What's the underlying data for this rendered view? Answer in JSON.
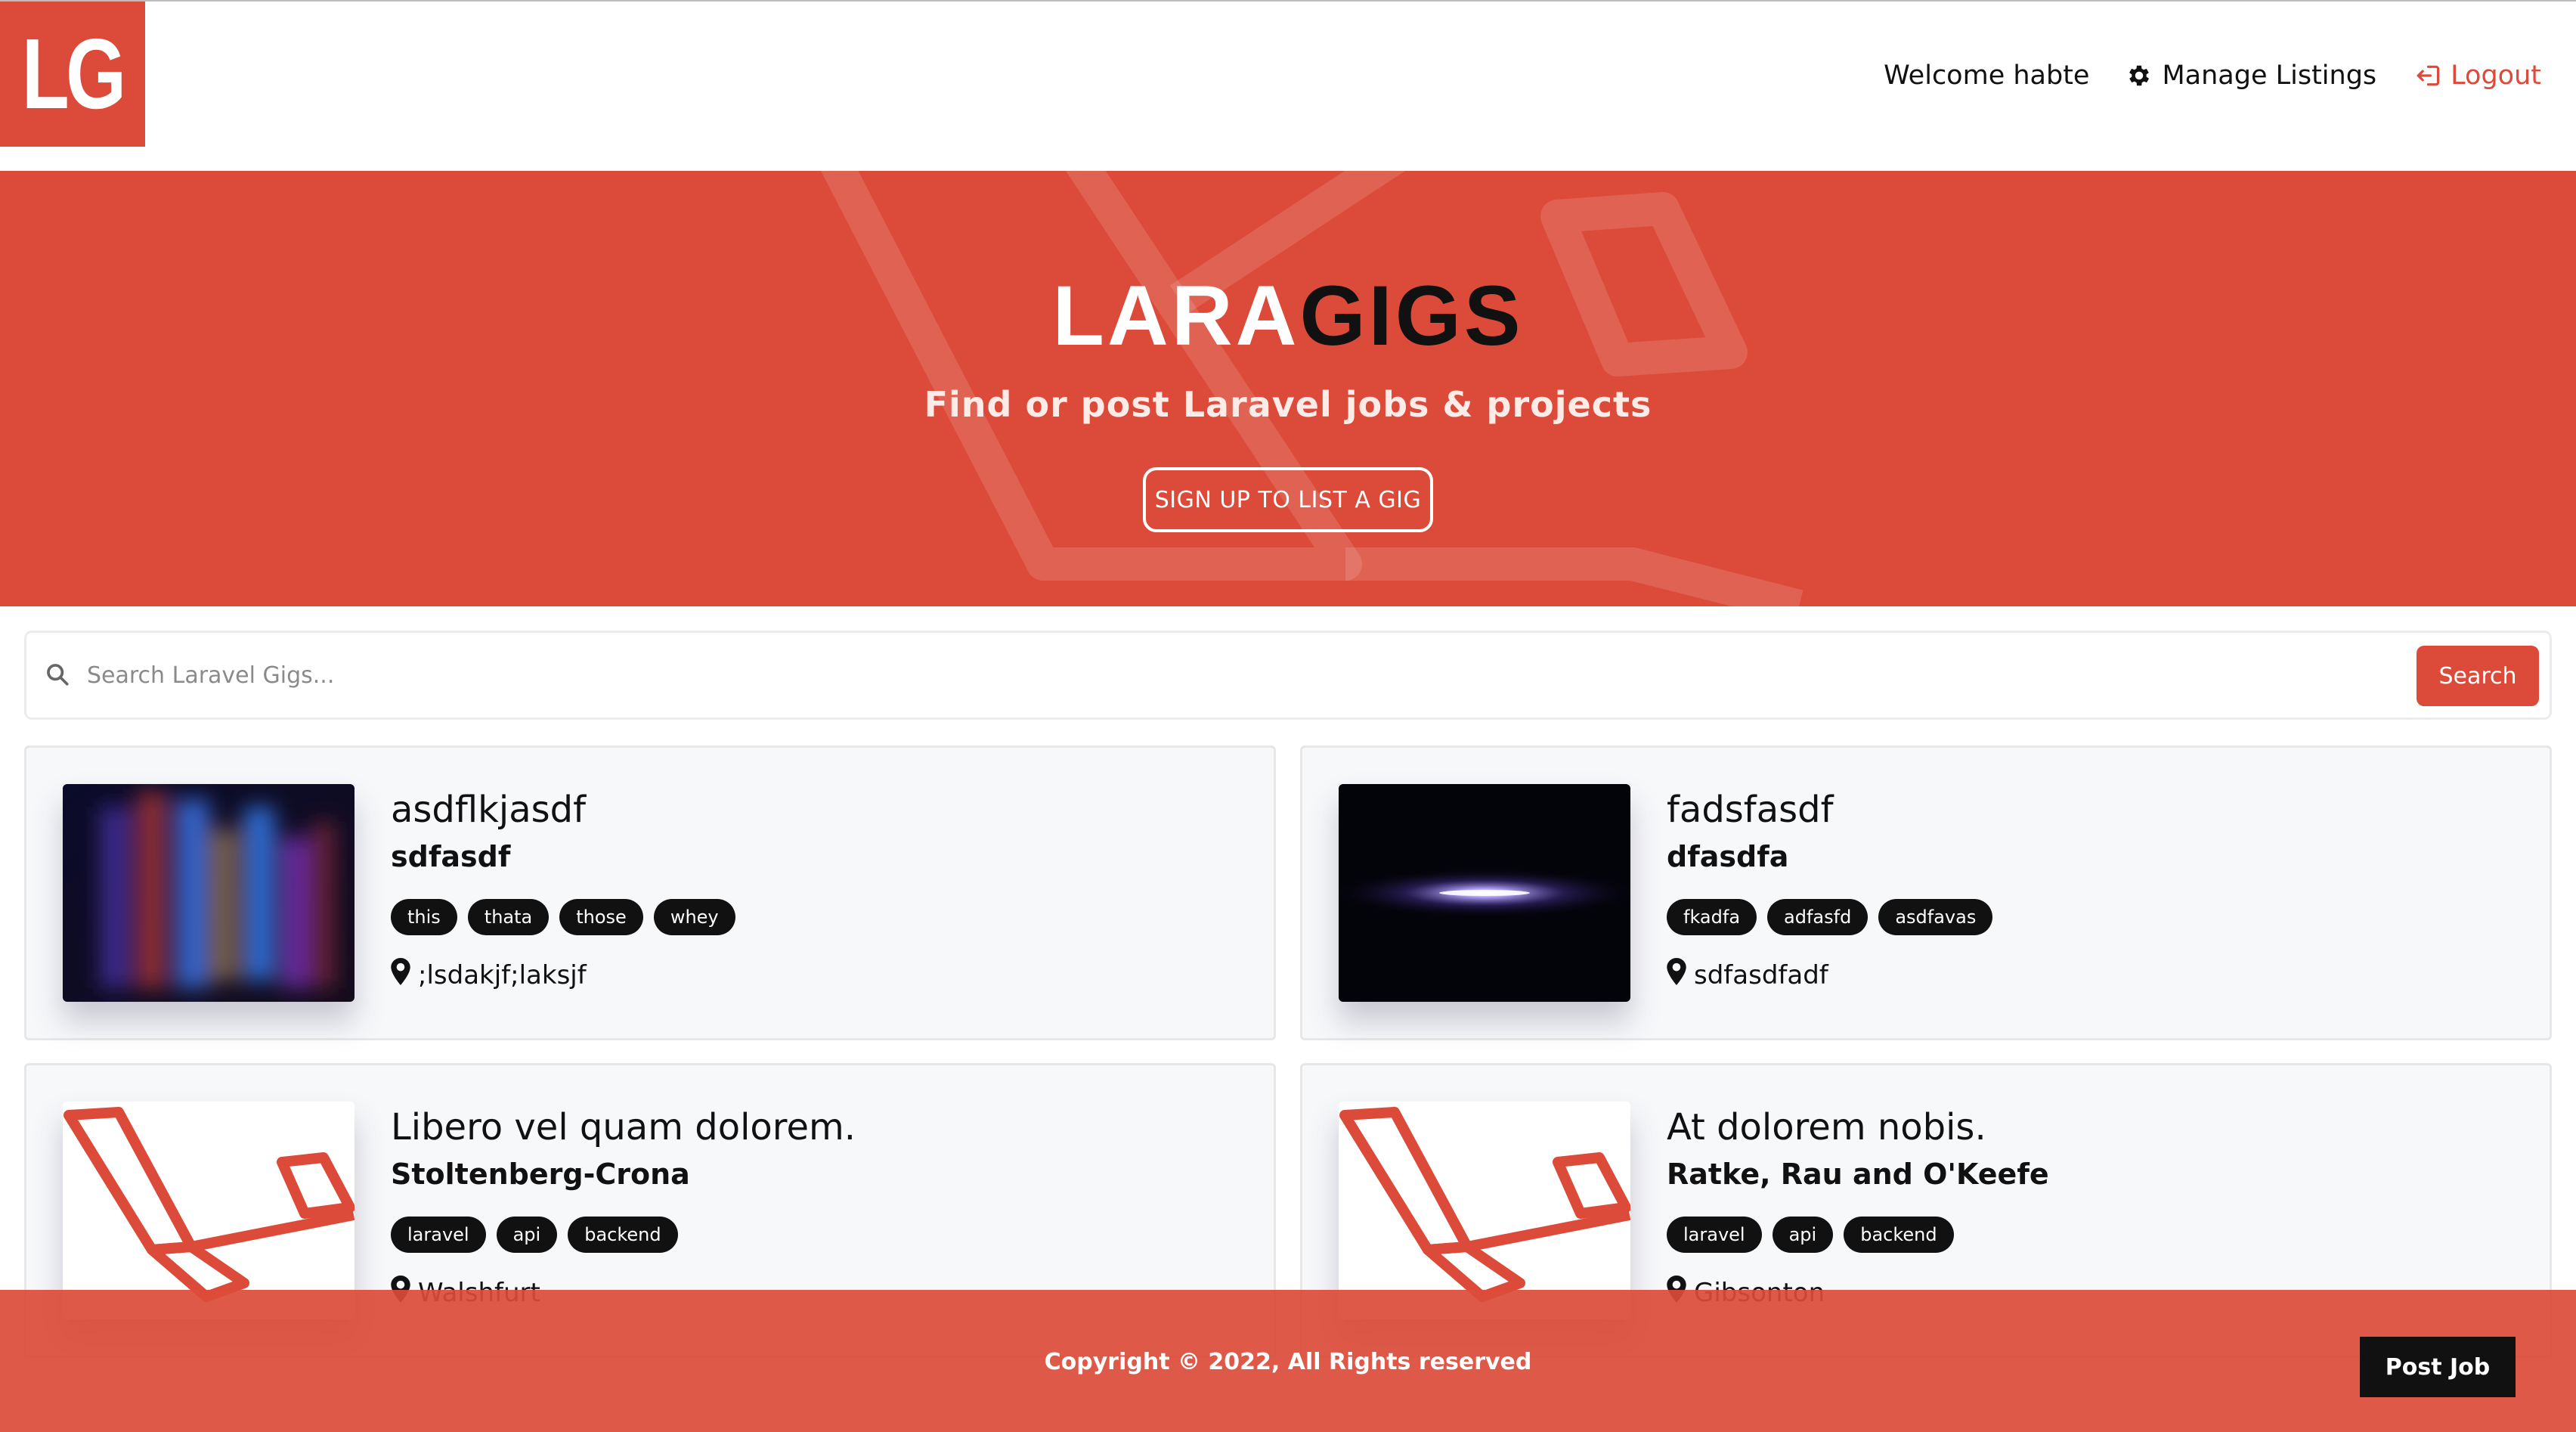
{
  "brand": {
    "logo_text": "LG",
    "accent": "#dc4b3a"
  },
  "nav": {
    "welcome": "Welcome habte",
    "manage": {
      "label": "Manage Listings",
      "icon": "gear-icon"
    },
    "logout": {
      "label": "Logout",
      "icon": "logout-icon"
    }
  },
  "hero": {
    "title_a": "LARA",
    "title_b": "GIGS",
    "subtitle": "Find or post Laravel jobs & projects",
    "cta": "SIGN UP TO LIST A GIG"
  },
  "search": {
    "placeholder": "Search Laravel Gigs...",
    "button": "Search",
    "icon": "search-icon"
  },
  "listings": [
    {
      "title": "asdflkjasdf",
      "company": "sdfasdf",
      "tags": [
        "this",
        "thata",
        "those",
        "whey"
      ],
      "location": ";lsdakjf;laksjf",
      "image": "abstract-blur"
    },
    {
      "title": "fadsfasdf",
      "company": "dfasdfa",
      "tags": [
        "fkadfa",
        "adfasfd",
        "asdfavas"
      ],
      "location": "sdfasdfadf",
      "image": "light-streak"
    },
    {
      "title": "Libero vel quam dolorem.",
      "company": "Stoltenberg-Crona",
      "tags": [
        "laravel",
        "api",
        "backend"
      ],
      "location": "Walshfurt",
      "image": "laravel-logo"
    },
    {
      "title": "At dolorem nobis.",
      "company": "Ratke, Rau and O'Keefe",
      "tags": [
        "laravel",
        "api",
        "backend"
      ],
      "location": "Gibsonton",
      "image": "laravel-logo"
    }
  ],
  "footer": {
    "copyright": "Copyright © 2022, All Rights reserved",
    "post_button": "Post Job"
  }
}
